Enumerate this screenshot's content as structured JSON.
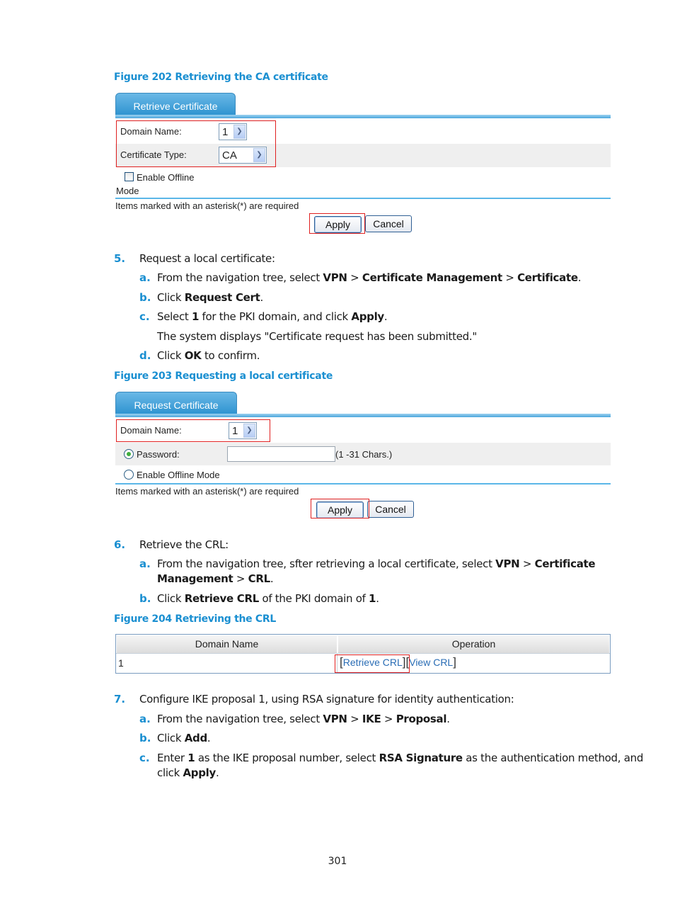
{
  "figures": {
    "fig202": {
      "caption": "Figure 202 Retrieving the CA certificate",
      "tab_label": "Retrieve Certificate",
      "domain_name_label": "Domain Name:",
      "domain_name_value": "1",
      "cert_type_label": "Certificate Type:",
      "cert_type_value": "CA",
      "offline_label_line1": "Enable Offline",
      "offline_label_line2": "Mode",
      "offline_checked": false,
      "required_note": "Items marked with an asterisk(*) are required",
      "apply_label": "Apply",
      "cancel_label": "Cancel"
    },
    "fig203": {
      "caption": "Figure 203 Requesting a local certificate",
      "tab_label": "Request Certificate",
      "domain_name_label": "Domain Name:",
      "domain_name_value": "1",
      "password_label": "Password:",
      "password_value": "",
      "password_hint": "(1 -31 Chars.)",
      "offline_label": "Enable Offline Mode",
      "selected_mode": "Password",
      "required_note": "Items marked with an asterisk(*) are required",
      "apply_label": "Apply",
      "cancel_label": "Cancel"
    },
    "fig204": {
      "caption": "Figure 204 Retrieving the CRL",
      "columns": [
        "Domain Name",
        "Operation"
      ],
      "rows": [
        {
          "domain": "1",
          "retrieve_link": "Retrieve CRL",
          "view_link": "View CRL"
        }
      ],
      "bracket_open": "[",
      "bracket_close": "]"
    }
  },
  "steps": {
    "s5": {
      "num": "5.",
      "text": "Request a local certificate:",
      "a": {
        "letter": "a.",
        "t1": "From the navigation tree, select ",
        "b1": "VPN",
        "t2": " > ",
        "b2": "Certificate Management",
        "t3": " > ",
        "b3": "Certificate",
        "t4": "."
      },
      "b": {
        "letter": "b.",
        "t1": "Click ",
        "b1": "Request Cert",
        "t2": "."
      },
      "c": {
        "letter": "c.",
        "t1": "Select ",
        "b1": "1",
        "t2": " for the PKI domain, and click ",
        "b2": "Apply",
        "t3": "."
      },
      "c_note": "The system displays \"Certificate request has been submitted.\"",
      "d": {
        "letter": "d.",
        "t1": "Click ",
        "b1": "OK",
        "t2": " to confirm."
      }
    },
    "s6": {
      "num": "6.",
      "text": "Retrieve the CRL:",
      "a": {
        "letter": "a.",
        "t1": "From the navigation tree, sfter retrieving a local certificate, select ",
        "b1": "VPN",
        "t2": " > ",
        "b2": "Certificate",
        "line2_b": "Management",
        "line2_t": " > ",
        "line2_b2": "CRL",
        "line2_t2": "."
      },
      "b": {
        "letter": "b.",
        "t1": "Click ",
        "b1": "Retrieve CRL",
        "t2": " of the PKI domain of ",
        "b2": "1",
        "t3": "."
      }
    },
    "s7": {
      "num": "7.",
      "text": "Configure IKE proposal 1, using RSA signature for identity authentication:",
      "a": {
        "letter": "a.",
        "t1": "From the navigation tree, select ",
        "b1": "VPN",
        "t2": " > ",
        "b2": "IKE",
        "t3": " > ",
        "b3": "Proposal",
        "t4": "."
      },
      "b": {
        "letter": "b.",
        "t1": "Click ",
        "b1": "Add",
        "t2": "."
      },
      "c": {
        "letter": "c.",
        "t1": "Enter ",
        "b1": "1",
        "t2": " as the IKE proposal number, select ",
        "b2": "RSA Signature",
        "t3": " as the authentication method, and",
        "line2_t": "click ",
        "line2_b": "Apply",
        "line2_t2": "."
      }
    }
  },
  "page_number": "301",
  "colors": {
    "accent": "#1a8fd1",
    "highlight_box": "#e02020",
    "link": "#2a6db5"
  }
}
